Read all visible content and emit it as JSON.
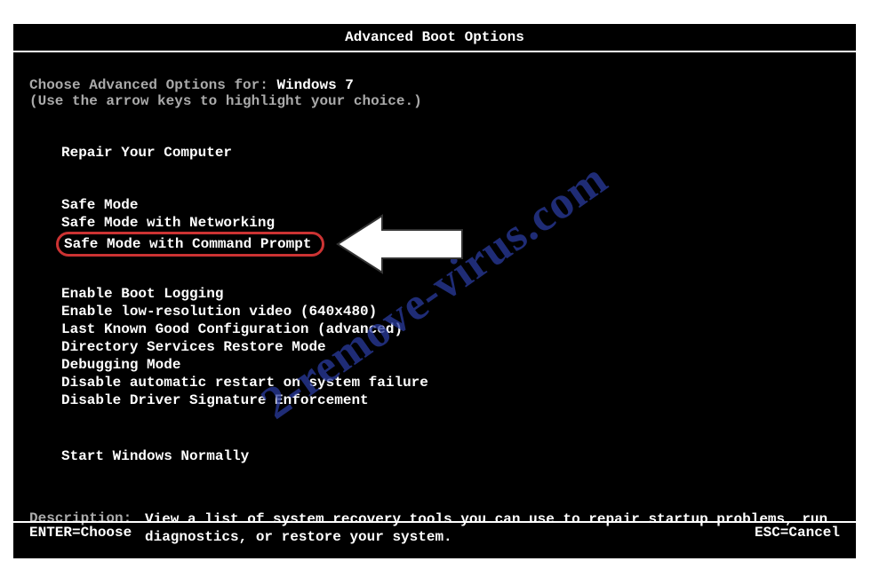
{
  "title": "Advanced Boot Options",
  "choose_prefix": "Choose Advanced Options for: ",
  "os_name": "Windows 7",
  "arrow_hint": "(Use the arrow keys to highlight your choice.)",
  "repair": "Repair Your Computer",
  "safe_modes": [
    "Safe Mode",
    "Safe Mode with Networking",
    "Safe Mode with Command Prompt"
  ],
  "highlighted_index": 2,
  "other_options": [
    "Enable Boot Logging",
    "Enable low-resolution video (640x480)",
    "Last Known Good Configuration (advanced)",
    "Directory Services Restore Mode",
    "Debugging Mode",
    "Disable automatic restart on system failure",
    "Disable Driver Signature Enforcement"
  ],
  "start_normal": "Start Windows Normally",
  "description_label": "Description:",
  "description_text": "View a list of system recovery tools you can use to repair startup problems, run diagnostics, or restore your system.",
  "footer": {
    "enter": "ENTER=Choose",
    "esc": "ESC=Cancel"
  },
  "watermark": "2-remove-virus.com"
}
